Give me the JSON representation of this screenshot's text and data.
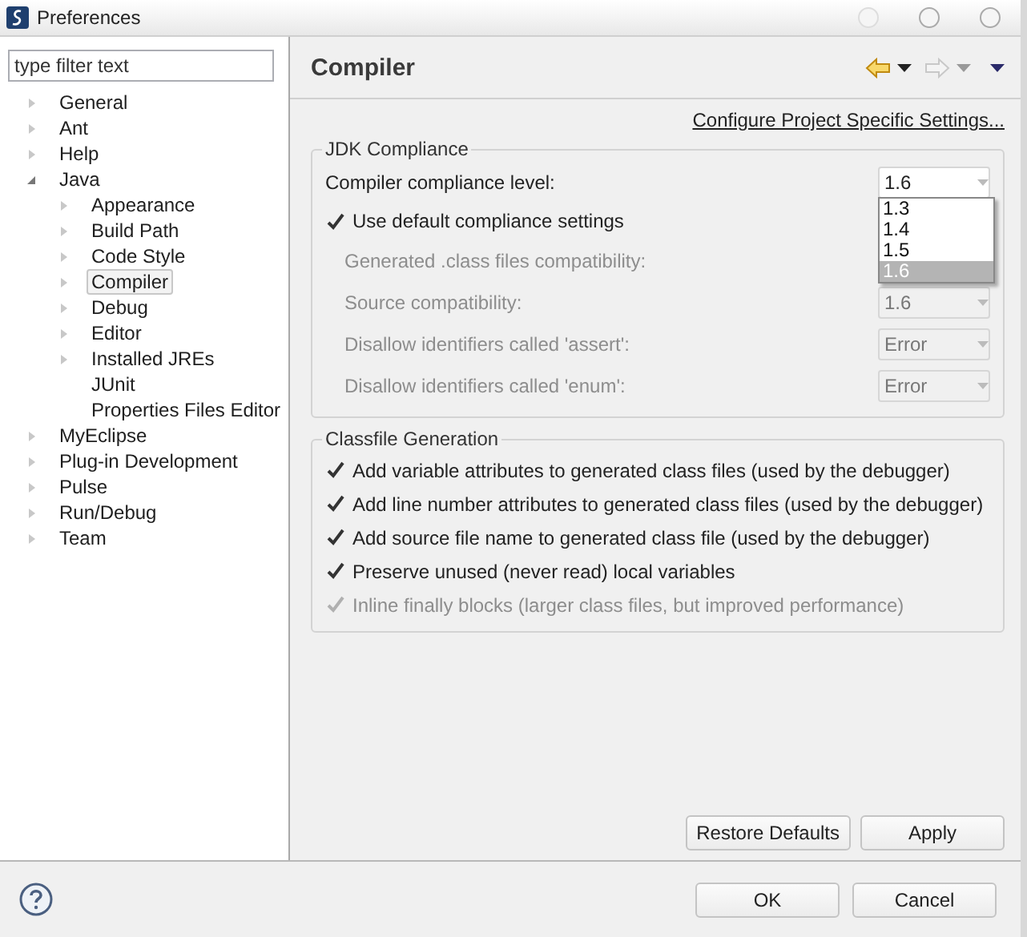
{
  "window": {
    "title": "Preferences"
  },
  "filter": {
    "placeholder": "type filter text"
  },
  "tree": [
    {
      "label": "General",
      "expanded": false,
      "selected": false
    },
    {
      "label": "Ant",
      "expanded": false,
      "selected": false
    },
    {
      "label": "Help",
      "expanded": false,
      "selected": false
    },
    {
      "label": "Java",
      "expanded": true,
      "selected": false,
      "children": [
        {
          "label": "Appearance",
          "expanded": false,
          "selected": false
        },
        {
          "label": "Build Path",
          "expanded": false,
          "selected": false
        },
        {
          "label": "Code Style",
          "expanded": false,
          "selected": false
        },
        {
          "label": "Compiler",
          "expanded": false,
          "selected": true
        },
        {
          "label": "Debug",
          "expanded": false,
          "selected": false
        },
        {
          "label": "Editor",
          "expanded": false,
          "selected": false
        },
        {
          "label": "Installed JREs",
          "expanded": false,
          "selected": false
        },
        {
          "label": "JUnit",
          "selected": false
        },
        {
          "label": "Properties Files Editor",
          "selected": false
        }
      ]
    },
    {
      "label": "MyEclipse",
      "expanded": false,
      "selected": false
    },
    {
      "label": "Plug-in Development",
      "expanded": false,
      "selected": false
    },
    {
      "label": "Pulse",
      "expanded": false,
      "selected": false
    },
    {
      "label": "Run/Debug",
      "expanded": false,
      "selected": false
    },
    {
      "label": "Team",
      "expanded": false,
      "selected": false
    }
  ],
  "page": {
    "title": "Compiler",
    "link": "Configure Project Specific Settings..."
  },
  "jdk": {
    "title": "JDK Compliance",
    "compliance": {
      "label": "Compiler compliance level:",
      "value": "1.6",
      "options": [
        {
          "label": "1.3",
          "selected": false
        },
        {
          "label": "1.4",
          "selected": false
        },
        {
          "label": "1.5",
          "selected": false
        },
        {
          "label": "1.6",
          "selected": true
        }
      ]
    },
    "use_default": {
      "label": "Use default compliance settings",
      "checked": true
    },
    "settings": [
      {
        "label": "Generated .class files compatibility:",
        "disabled": true
      },
      {
        "label": "Source compatibility:",
        "value": "1.6",
        "disabled": true
      },
      {
        "label": "Disallow identifiers called 'assert':",
        "value": "Error",
        "disabled": true
      },
      {
        "label": "Disallow identifiers called 'enum':",
        "value": "Error",
        "disabled": true
      }
    ]
  },
  "classfile": {
    "title": "Classfile Generation",
    "options": [
      {
        "label": "Add variable attributes to generated class files (used by the debugger)",
        "checked": true,
        "disabled": false
      },
      {
        "label": "Add line number attributes to generated class files (used by the debugger)",
        "checked": true,
        "disabled": false
      },
      {
        "label": "Add source file name to generated class file (used by the debugger)",
        "checked": true,
        "disabled": false
      },
      {
        "label": "Preserve unused (never read) local variables",
        "checked": true,
        "disabled": false
      },
      {
        "label": "Inline finally blocks (larger class files, but improved performance)",
        "checked": true,
        "disabled": true
      }
    ]
  },
  "page_buttons": [
    "Restore Defaults",
    "Apply"
  ],
  "dialog_buttons": [
    "OK",
    "Cancel"
  ]
}
